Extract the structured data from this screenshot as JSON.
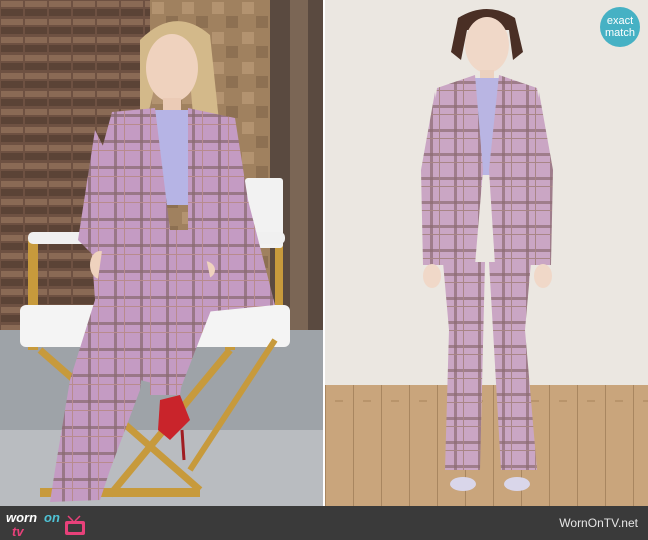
{
  "badge": {
    "line1": "exact",
    "line2": "match",
    "color": "#46b1c4"
  },
  "footer": {
    "logo_word1": "worn",
    "logo_word2": "on",
    "logo_word3": "tv",
    "site_name": "WornOnTV.net",
    "logo_icon": "tv-icon"
  },
  "colors": {
    "plaid_base": "#c9a3c5",
    "plaid_line": "#8d6d73",
    "shirt": "#b7b6e6",
    "shoe_left": "#c9242b",
    "footer_bg": "#3a3a3a"
  }
}
